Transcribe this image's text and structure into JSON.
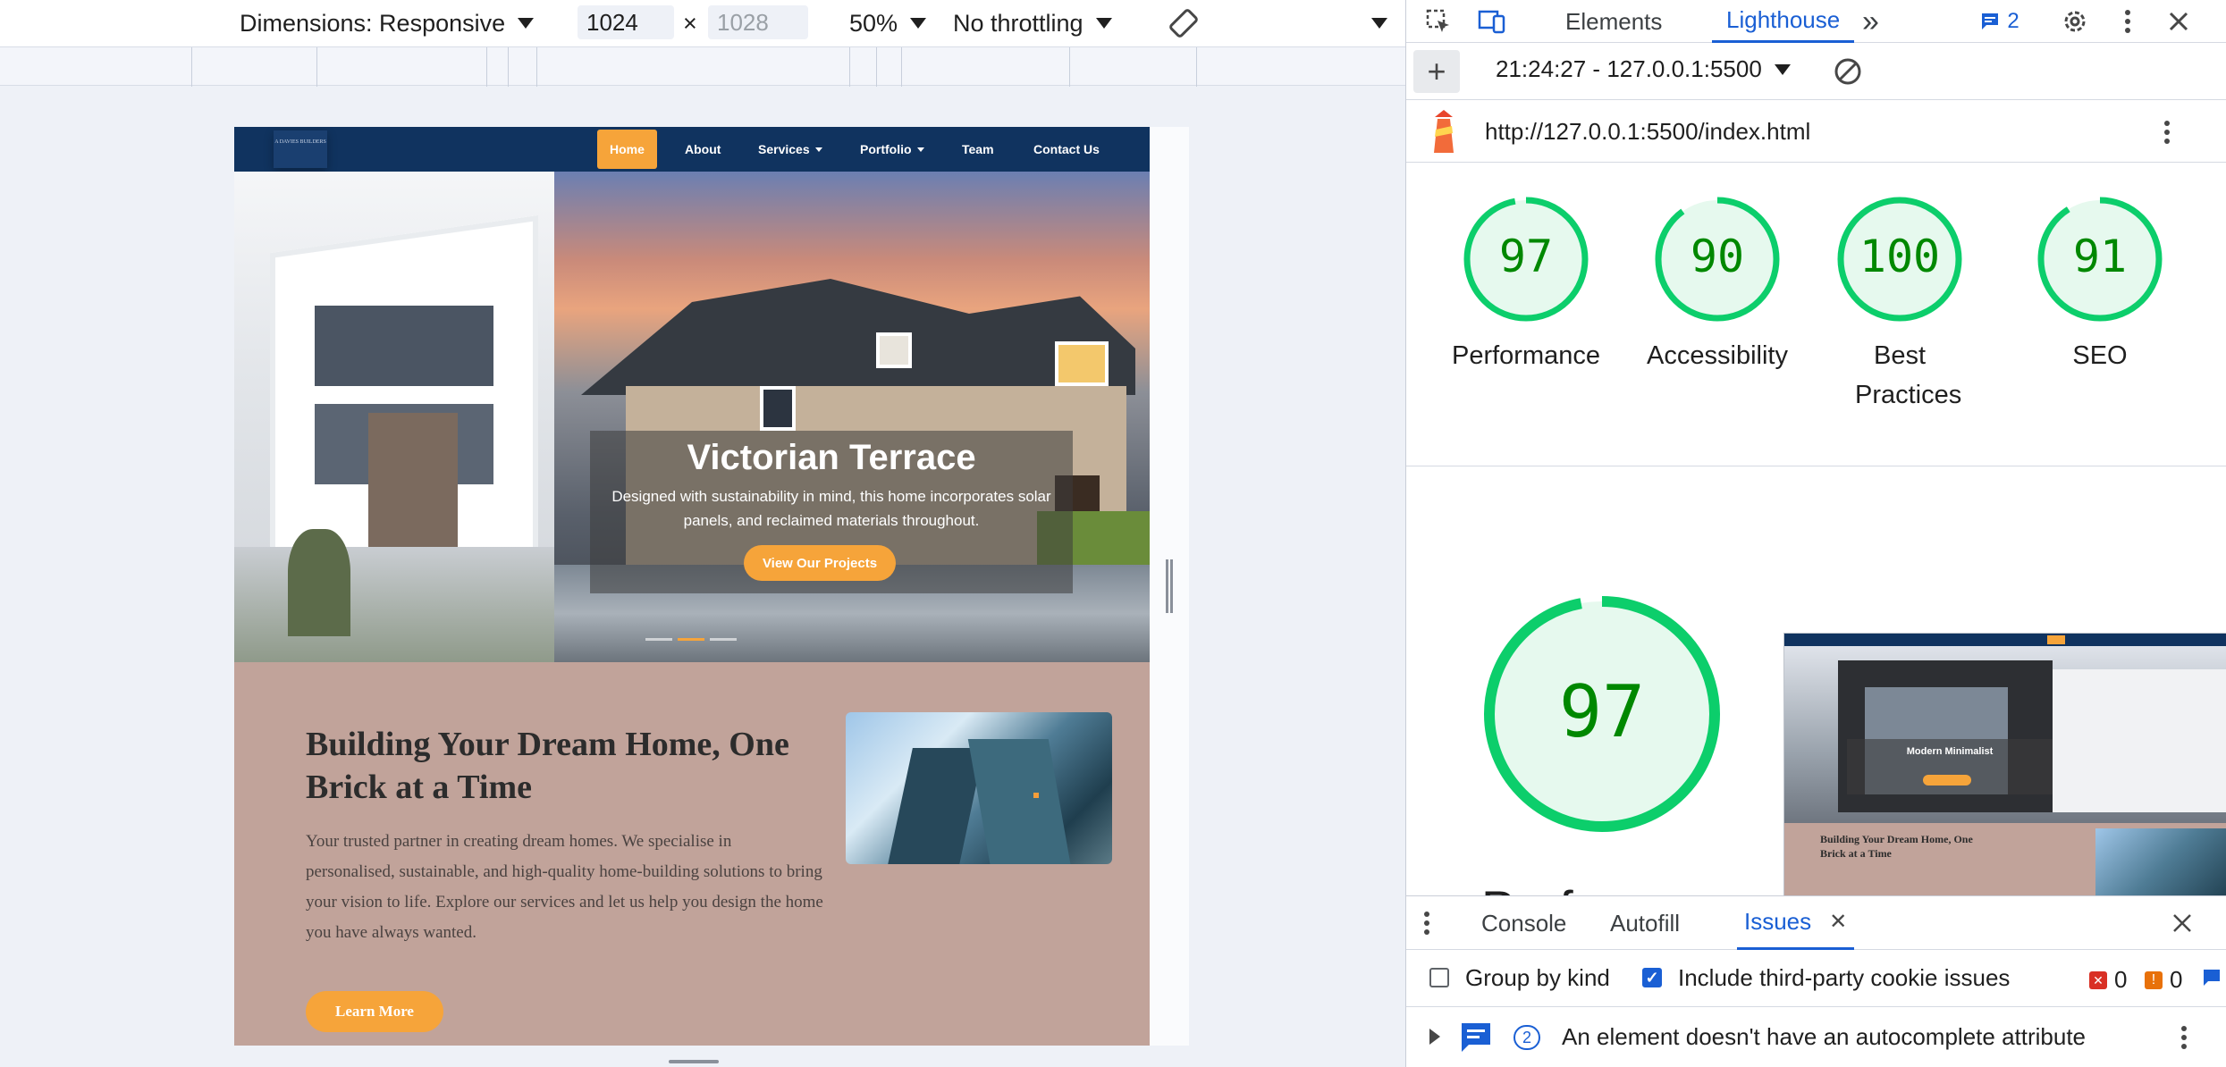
{
  "device_toolbar": {
    "dimensions_label": "Dimensions: Responsive",
    "width_value": "1024",
    "times": "×",
    "height_placeholder": "1028",
    "zoom": "50%",
    "throttling": "No throttling"
  },
  "site": {
    "nav": {
      "logo_text": "A DAVIES BUILDERS",
      "items": [
        {
          "label": "Home"
        },
        {
          "label": "About"
        },
        {
          "label": "Services"
        },
        {
          "label": "Portfolio"
        },
        {
          "label": "Team"
        },
        {
          "label": "Contact Us"
        }
      ]
    },
    "hero": {
      "title": "Victorian Terrace",
      "description": "Designed with sustainability in mind, this home incorporates solar panels, and reclaimed materials throughout.",
      "button": "View Our Projects"
    },
    "about": {
      "title": "Building Your Dream Home, One Brick at a Time",
      "text": "Your trusted partner in creating dream homes. We specialise in personalised, sustainable, and high-quality home-building solutions to bring your vision to life. Explore our services and let us help you design the home you have always wanted.",
      "button": "Learn More"
    }
  },
  "devtools": {
    "tabs": [
      {
        "label": "Elements"
      },
      {
        "label": "Lighthouse"
      }
    ],
    "more_tabs": "»",
    "issues_count": "2",
    "report_time": "21:24:27 - 127.0.0.1:5500",
    "report_url": "http://127.0.0.1:5500/index.html",
    "scores": [
      {
        "value": "97",
        "label": "Performance",
        "score": 97
      },
      {
        "value": "90",
        "label": "Accessibility",
        "score": 90
      },
      {
        "value": "100",
        "label": "Best Practices",
        "score": 100
      },
      {
        "value": "91",
        "label": "SEO",
        "score": 91
      }
    ],
    "big_score": {
      "value": "97",
      "score": 97,
      "label_partial": "Perf"
    },
    "thumbnail": {
      "hero_title": "Modern Minimalist",
      "about_title": "Building Your Dream Home, One Brick at a Time"
    },
    "drawer": {
      "tabs": [
        {
          "label": "Console"
        },
        {
          "label": "Autofill"
        },
        {
          "label": "Issues"
        }
      ],
      "group_by_kind": "Group by kind",
      "include_third_party": "Include third-party cookie issues",
      "error_count": "0",
      "warning_count": "0",
      "issue_badge": "2",
      "issue_text": "An element doesn't have an autocomplete attribute"
    },
    "colors": {
      "accent": "#1a5fd4",
      "score_good": "#0cce6b",
      "score_text": "#008800"
    }
  }
}
